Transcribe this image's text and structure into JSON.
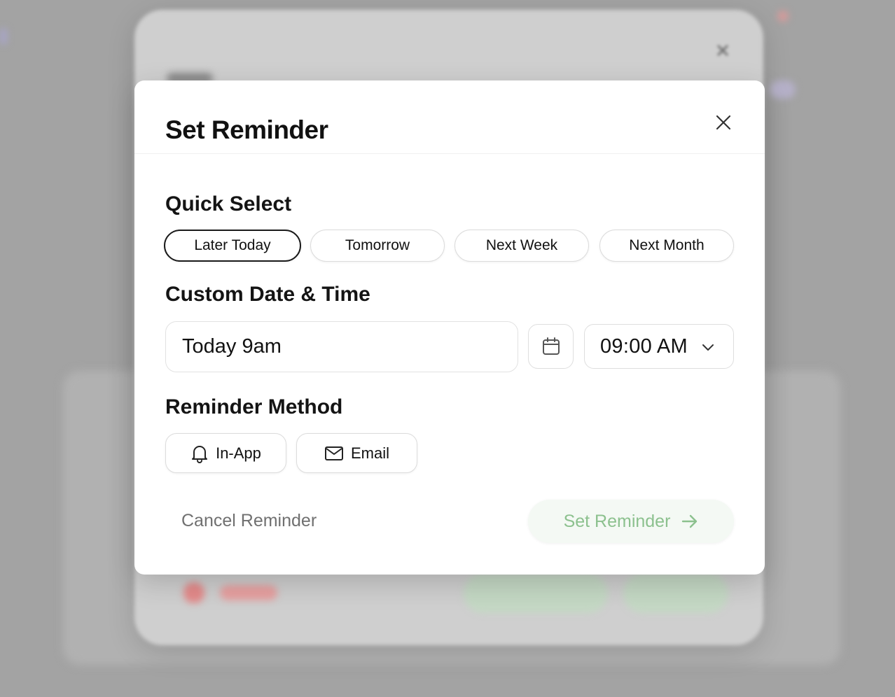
{
  "modal": {
    "title": "Set Reminder",
    "close_icon": "close-icon"
  },
  "quick_select": {
    "label": "Quick Select",
    "options": [
      {
        "label": "Later Today",
        "selected": true
      },
      {
        "label": "Tomorrow",
        "selected": false
      },
      {
        "label": "Next Week",
        "selected": false
      },
      {
        "label": "Next Month",
        "selected": false
      }
    ]
  },
  "custom": {
    "label": "Custom Date & Time",
    "date_value": "Today 9am",
    "calendar_icon": "calendar-icon",
    "time_value": "09:00 AM",
    "chevron_icon": "chevron-down-icon"
  },
  "method": {
    "label": "Reminder Method",
    "options": [
      {
        "label": "In-App",
        "icon": "bell-icon"
      },
      {
        "label": "Email",
        "icon": "mail-icon"
      }
    ]
  },
  "footer": {
    "cancel_label": "Cancel Reminder",
    "submit_label": "Set Reminder",
    "submit_icon": "arrow-right-icon"
  },
  "colors": {
    "submit_text": "#8cc18e",
    "submit_bg": "#f4f9f4",
    "cancel_text": "#707070",
    "backdrop": "#a3a3a3"
  }
}
